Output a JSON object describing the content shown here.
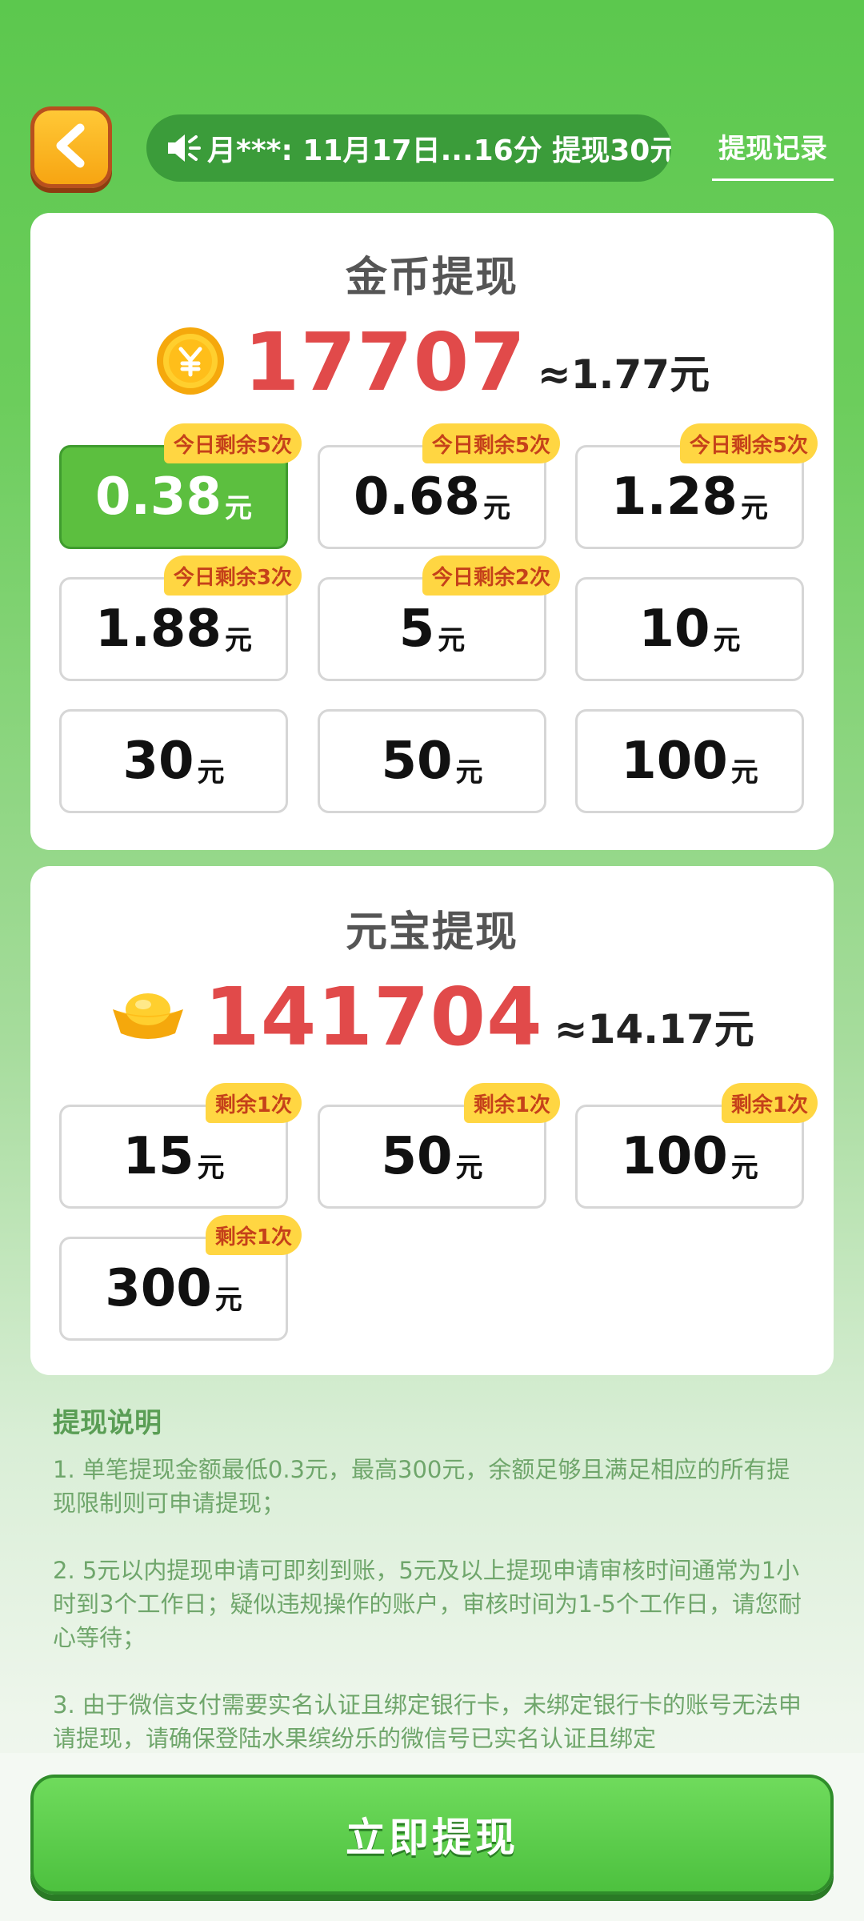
{
  "header": {
    "back_icon": "chevron-left-icon",
    "ticker_icon": "speaker-icon",
    "ticker_text": "月***: 11月17日...16分 提现30元",
    "record_link": "提现记录"
  },
  "coin_section": {
    "title": "金币提现",
    "icon": "gold-coin-icon",
    "balance": "17707",
    "approx": "≈1.77元",
    "options": [
      {
        "value": "0.38",
        "unit": "元",
        "badge": "今日剩余5次",
        "selected": true
      },
      {
        "value": "0.68",
        "unit": "元",
        "badge": "今日剩余5次",
        "selected": false
      },
      {
        "value": "1.28",
        "unit": "元",
        "badge": "今日剩余5次",
        "selected": false
      },
      {
        "value": "1.88",
        "unit": "元",
        "badge": "今日剩余3次",
        "selected": false
      },
      {
        "value": "5",
        "unit": "元",
        "badge": "今日剩余2次",
        "selected": false
      },
      {
        "value": "10",
        "unit": "元",
        "badge": "",
        "selected": false
      },
      {
        "value": "30",
        "unit": "元",
        "badge": "",
        "selected": false
      },
      {
        "value": "50",
        "unit": "元",
        "badge": "",
        "selected": false
      },
      {
        "value": "100",
        "unit": "元",
        "badge": "",
        "selected": false
      }
    ]
  },
  "ingot_section": {
    "title": "元宝提现",
    "icon": "gold-ingot-icon",
    "balance": "141704",
    "approx": "≈14.17元",
    "options": [
      {
        "value": "15",
        "unit": "元",
        "badge": "剩余1次"
      },
      {
        "value": "50",
        "unit": "元",
        "badge": "剩余1次"
      },
      {
        "value": "100",
        "unit": "元",
        "badge": "剩余1次"
      },
      {
        "value": "300",
        "unit": "元",
        "badge": "剩余1次"
      }
    ]
  },
  "notes": {
    "title": "提现说明",
    "items": [
      "1. 单笔提现金额最低0.3元，最高300元，余额足够且满足相应的所有提现限制则可申请提现；",
      "2. 5元以内提现申请可即刻到账，5元及以上提现申请审核时间通常为1小时到3个工作日；疑似违规操作的账户，审核时间为1-5个工作日，请您耐心等待；",
      "3. 由于微信支付需要实名认证且绑定银行卡，未绑定银行卡的账号无法申请提现，请确保登陆水果缤纷乐的微信号已实名认证且绑定"
    ]
  },
  "footer": {
    "withdraw_button": "立即提现"
  },
  "colors": {
    "accent_green": "#5cbf3f",
    "balance_red": "#e14a4a",
    "badge_yellow": "#ffd642"
  }
}
